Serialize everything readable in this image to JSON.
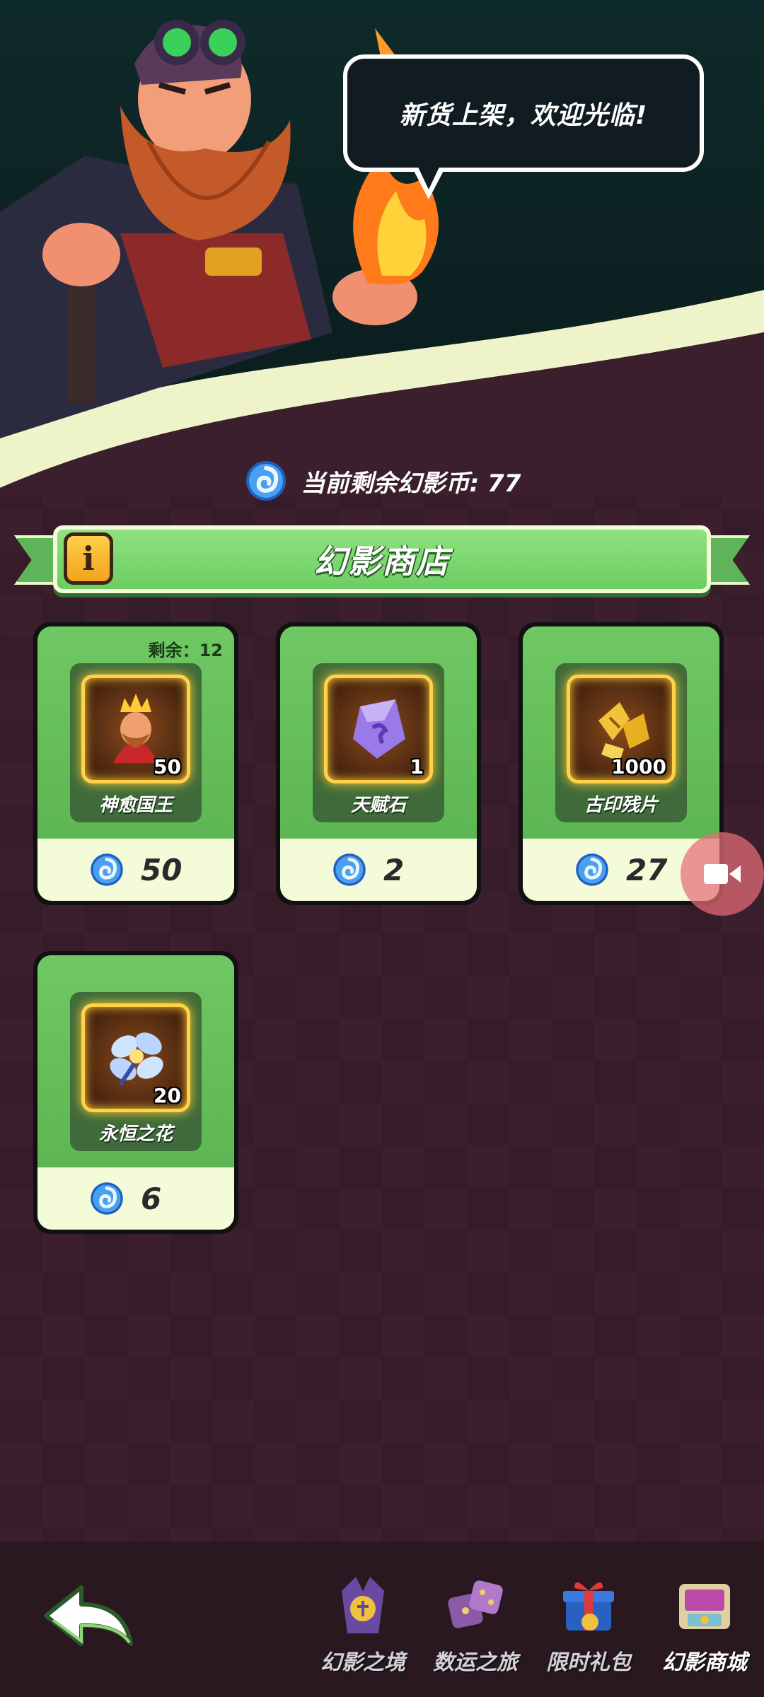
{
  "header": {
    "greeting": "新货上架，欢迎光临!"
  },
  "balance": {
    "label": "当前剩余幻影币: 77",
    "icon": "phantom-coin-icon"
  },
  "shop": {
    "title": "幻影商店",
    "info_icon_text": "i",
    "items": [
      {
        "name": "神愈国王",
        "quantity": "50",
        "price": "50",
        "remaining": "剩余：12",
        "icon": "king-hero-icon"
      },
      {
        "name": "天赋石",
        "quantity": "1",
        "price": "2",
        "remaining": "",
        "icon": "talent-stone-icon"
      },
      {
        "name": "古印残片",
        "quantity": "1000",
        "price": "27",
        "remaining": "",
        "icon": "seal-fragment-icon"
      },
      {
        "name": "永恒之花",
        "quantity": "20",
        "price": "6",
        "remaining": "",
        "icon": "eternal-flower-icon"
      }
    ]
  },
  "nav": {
    "items": [
      {
        "label": "幻影之境",
        "icon": "phantom-realm-icon",
        "active": false
      },
      {
        "label": "数运之旅",
        "icon": "dice-journey-icon",
        "active": false
      },
      {
        "label": "限时礼包",
        "icon": "gift-pack-icon",
        "active": false
      },
      {
        "label": "幻影商城",
        "icon": "phantom-mall-icon",
        "active": true
      }
    ]
  },
  "colors": {
    "background": "#3c1f2c",
    "card_green": "#6fc863",
    "gold_frame": "#ffd24a",
    "coin_blue": "#3b8ae6"
  }
}
